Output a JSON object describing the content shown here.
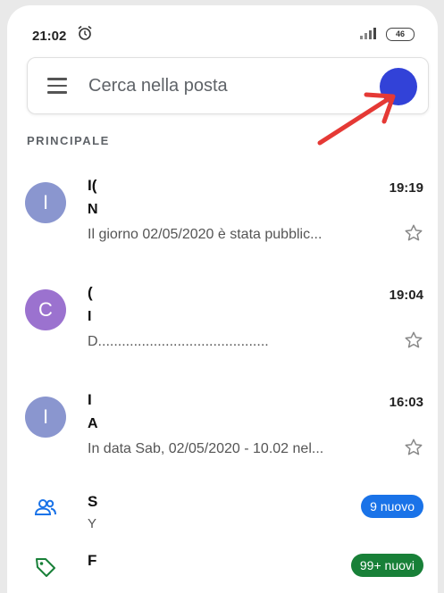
{
  "status_bar": {
    "time": "21:02",
    "battery": "46"
  },
  "search": {
    "placeholder": "Cerca nella posta"
  },
  "section": {
    "label": "PRINCIPALE"
  },
  "emails": [
    {
      "avatar_letter": "I",
      "avatar_color": "#8a96cf",
      "sender": "I(",
      "subject": "N",
      "snippet": "Il giorno 02/05/2020 è stata pubblic...",
      "time": "19:19"
    },
    {
      "avatar_letter": "C",
      "avatar_color": "#9b72cf",
      "sender": "(",
      "subject": "I",
      "snippet": "D...........................................",
      "time": "19:04"
    },
    {
      "avatar_letter": "I",
      "avatar_color": "#8a96cf",
      "sender": "I",
      "subject": "A",
      "snippet": "In data Sab, 02/05/2020 - 10.02 nel...",
      "time": "16:03"
    }
  ],
  "categories": [
    {
      "icon": "people-icon",
      "title": "S",
      "subtitle": "Y",
      "badge": "9 nuovo",
      "badge_color": "#1a73e8"
    },
    {
      "icon": "tag-icon",
      "title": "F",
      "subtitle": "",
      "badge": "99+ nuovi",
      "badge_color": "#188038"
    }
  ],
  "colors": {
    "accent_arrow": "#e53935",
    "account_avatar": "#3242d8"
  }
}
